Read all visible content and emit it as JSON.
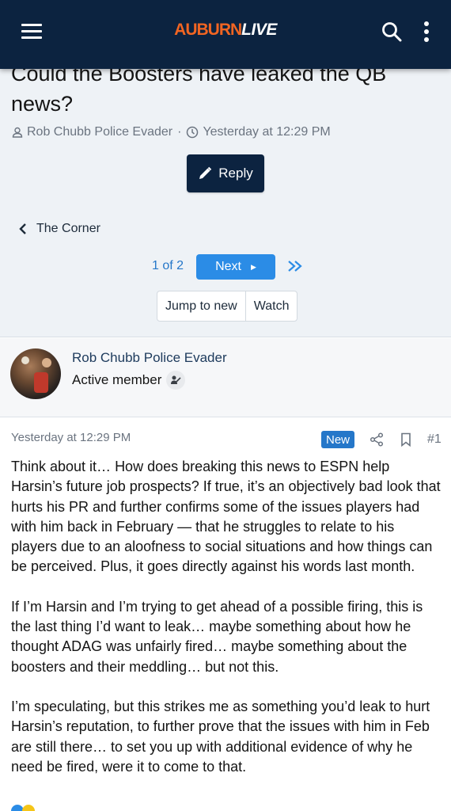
{
  "header": {
    "logo_part1": "AUBURN",
    "logo_part2": "LIVE"
  },
  "thread": {
    "title": "Could the Boosters have leaked the QB news?",
    "author": "Rob Chubb Police Evader",
    "separator": "·",
    "timestamp": "Yesterday at 12:29 PM",
    "reply_label": "Reply",
    "breadcrumb": "The Corner"
  },
  "pagination": {
    "current": "1 of 2",
    "next_label": "Next"
  },
  "actions": {
    "jump_label": "Jump to new",
    "watch_label": "Watch"
  },
  "post": {
    "author_name": "Rob Chubb Police Evader",
    "author_title": "Active member",
    "date": "Yesterday at 12:29 PM",
    "new_badge": "New",
    "number": "#1",
    "paragraphs": [
      "Think about it… How does breaking this news to ESPN help Harsin’s future job prospects? If true, it’s an objectively bad look that hurts his PR and further confirms some of the issues players had with him back in February — that he struggles to relate to his players due to an aloofness to social situations and how things can be perceived. Plus, it goes directly against his words last month.",
      "If I’m Harsin and I’m trying to get ahead of a possible firing, this is the last thing I’d want to leak… maybe something about how he thought ADAG was unfairly fired… maybe something about the boosters and their meddling… but not this.",
      "I’m speculating, but this strikes me as something you’d leak to hurt Harsin’s reputation, to further prove that the issues with him in Feb are still there… to set you up with additional evidence of why he need be fired, were it to come to that."
    ]
  },
  "colors": {
    "navy": "#0c2340",
    "orange": "#f26522",
    "blue": "#2b8ce6"
  }
}
